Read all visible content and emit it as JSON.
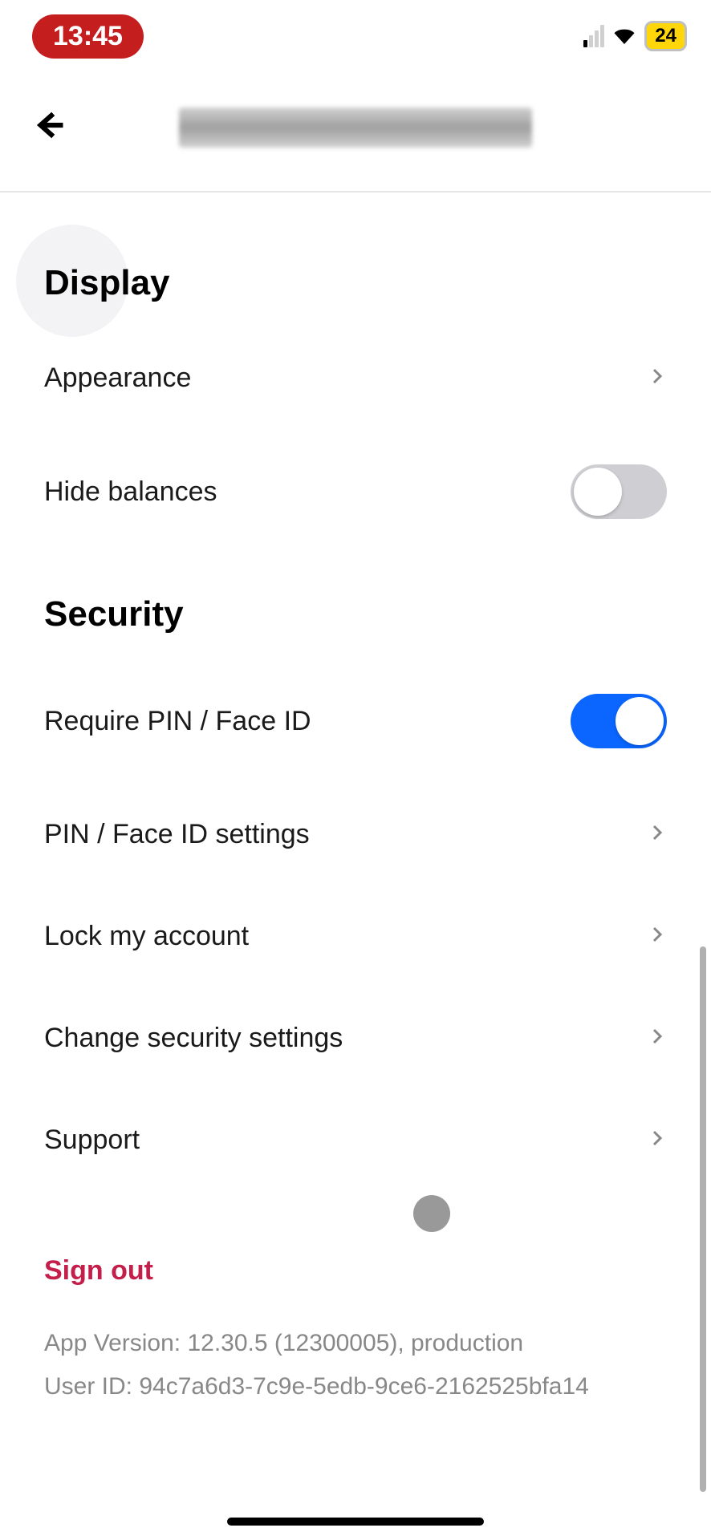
{
  "status": {
    "time": "13:45",
    "battery": "24"
  },
  "sections": {
    "display": {
      "title": "Display",
      "appearance": "Appearance",
      "hide_balances": "Hide balances",
      "hide_balances_on": false
    },
    "security": {
      "title": "Security",
      "require_pin": "Require PIN / Face ID",
      "require_pin_on": true,
      "pin_settings": "PIN / Face ID settings",
      "lock_account": "Lock my account",
      "change_security": "Change security settings",
      "support": "Support"
    }
  },
  "signout": "Sign out",
  "footer": {
    "app_version": "App Version: 12.30.5 (12300005), production",
    "user_id": "User ID: 94c7a6d3-7c9e-5edb-9ce6-2162525bfa14"
  }
}
